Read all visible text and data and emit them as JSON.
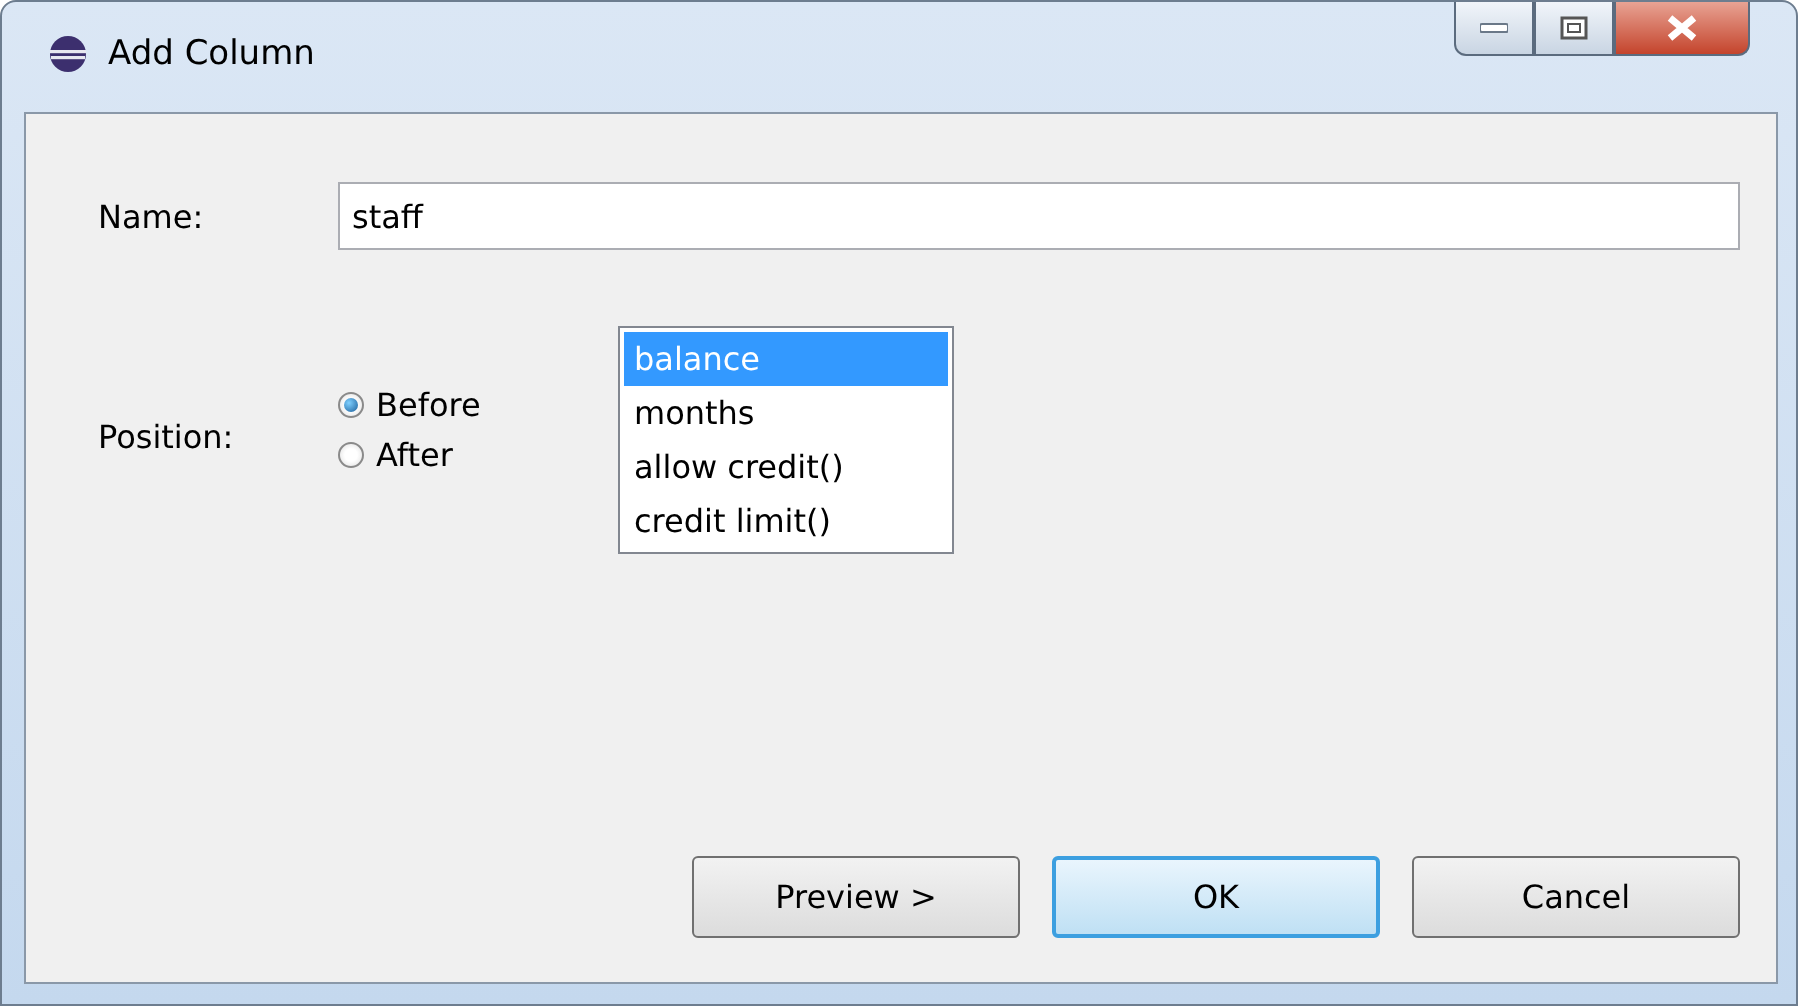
{
  "window": {
    "title": "Add Column"
  },
  "name_field": {
    "label": "Name:",
    "value": "staff"
  },
  "position": {
    "label": "Position:",
    "options": [
      {
        "label": "Before",
        "selected": true
      },
      {
        "label": "After",
        "selected": false
      }
    ]
  },
  "column_list": [
    {
      "label": "balance",
      "selected": true
    },
    {
      "label": "months",
      "selected": false
    },
    {
      "label": "allow credit()",
      "selected": false
    },
    {
      "label": "credit limit()",
      "selected": false
    }
  ],
  "buttons": [
    {
      "label": "Preview >",
      "default": false
    },
    {
      "label": "OK",
      "default": true
    },
    {
      "label": "Cancel",
      "default": false
    }
  ]
}
